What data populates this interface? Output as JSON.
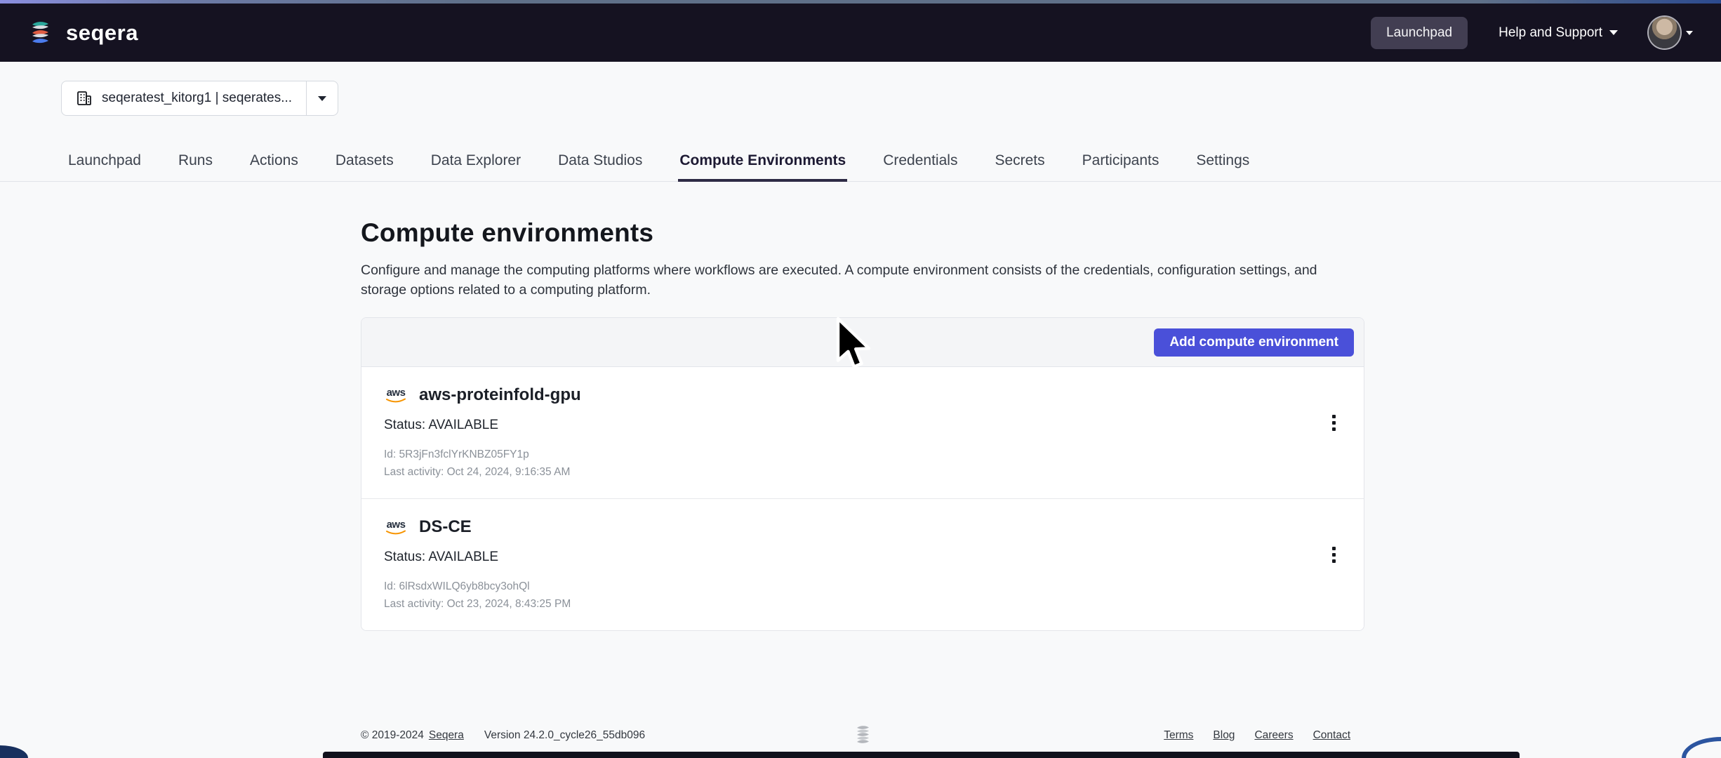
{
  "navbar": {
    "brand": "seqera",
    "launchpad_label": "Launchpad",
    "help_label": "Help and Support"
  },
  "workspace": {
    "selector_value": "seqeratest_kitorg1 | seqerates..."
  },
  "tabs": [
    {
      "label": "Launchpad"
    },
    {
      "label": "Runs"
    },
    {
      "label": "Actions"
    },
    {
      "label": "Datasets"
    },
    {
      "label": "Data Explorer"
    },
    {
      "label": "Data Studios"
    },
    {
      "label": "Compute Environments",
      "active": true
    },
    {
      "label": "Credentials"
    },
    {
      "label": "Secrets"
    },
    {
      "label": "Participants"
    },
    {
      "label": "Settings"
    }
  ],
  "page": {
    "title": "Compute environments",
    "description": "Configure and manage the computing platforms where workflows are executed. A compute environment consists of the credentials, configuration settings, and storage options related to a computing platform."
  },
  "toolbar": {
    "add_button_label": "Add compute environment",
    "accent_color": "#4a50d9"
  },
  "environments": [
    {
      "provider": "aws",
      "name": "aws-proteinfold-gpu",
      "status_label": "Status: AVAILABLE",
      "id_label": "Id: 5R3jFn3fclYrKNBZ05FY1p",
      "last_activity_label": "Last activity: Oct 24, 2024, 9:16:35 AM"
    },
    {
      "provider": "aws",
      "name": "DS-CE",
      "status_label": "Status: AVAILABLE",
      "id_label": "Id: 6lRsdxWILQ6yb8bcy3ohQl",
      "last_activity_label": "Last activity: Oct 23, 2024, 8:43:25 PM"
    }
  ],
  "footer": {
    "copyright": "© 2019-2024",
    "company_link": "Seqera",
    "version": "Version 24.2.0_cycle26_55db096",
    "links": [
      {
        "label": "Terms"
      },
      {
        "label": "Blog"
      },
      {
        "label": "Careers"
      },
      {
        "label": "Contact"
      }
    ]
  }
}
